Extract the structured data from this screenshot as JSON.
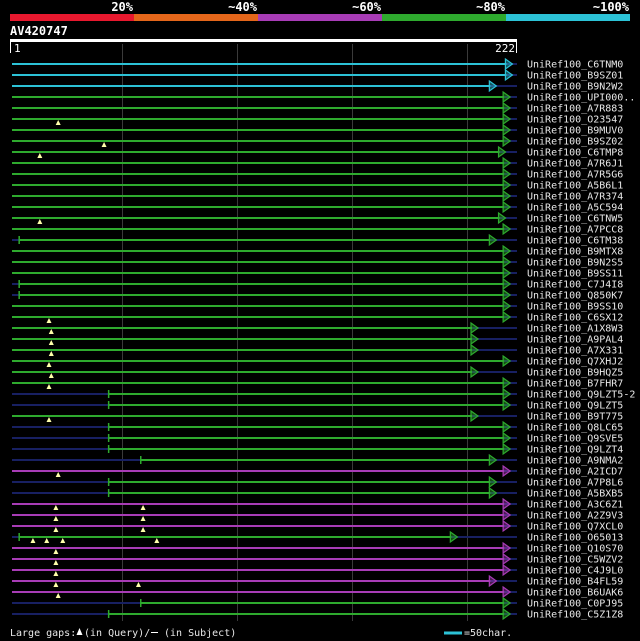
{
  "chart_data": {
    "type": "bar",
    "orientation": "horizontal",
    "query_name": "AV420747",
    "x_range": [
      1,
      222
    ],
    "x_tick_labels": [
      "1",
      "222"
    ],
    "grid": true,
    "grid_interval": 50,
    "legend_placement": "top",
    "legend": [
      {
        "label": "20%",
        "color": "#e8182e"
      },
      {
        "label": "~40%",
        "color": "#e4661a"
      },
      {
        "label": "~60%",
        "color": "#a83cb6"
      },
      {
        "label": "~80%",
        "color": "#2eaa2e"
      },
      {
        "label": "~100%",
        "color": "#2cc2d6"
      }
    ],
    "hits": [
      {
        "name": "UniRef100_C6TNM0",
        "identity": "~100%",
        "start": 1,
        "end": 220
      },
      {
        "name": "UniRef100_B9SZ01",
        "identity": "~100%",
        "start": 1,
        "end": 220
      },
      {
        "name": "UniRef100_B9N2W2",
        "identity": "~100%",
        "start": 1,
        "end": 213
      },
      {
        "name": "UniRef100_UPI000..",
        "identity": "~80%",
        "start": 1,
        "end": 219
      },
      {
        "name": "UniRef100_A7R883",
        "identity": "~80%",
        "start": 1,
        "end": 219
      },
      {
        "name": "UniRef100_O23547",
        "identity": "~80%",
        "start": 1,
        "end": 219,
        "query_gaps": [
          22
        ]
      },
      {
        "name": "UniRef100_B9MUV0",
        "identity": "~80%",
        "start": 1,
        "end": 219
      },
      {
        "name": "UniRef100_B9SZ02",
        "identity": "~80%",
        "start": 1,
        "end": 219,
        "query_gaps": [
          42
        ]
      },
      {
        "name": "UniRef100_C6TMP8",
        "identity": "~80%",
        "start": 1,
        "end": 217,
        "query_gaps": [
          14
        ]
      },
      {
        "name": "UniRef100_A7R6J1",
        "identity": "~80%",
        "start": 1,
        "end": 219
      },
      {
        "name": "UniRef100_A7R5G6",
        "identity": "~80%",
        "start": 1,
        "end": 219
      },
      {
        "name": "UniRef100_A5B6L1",
        "identity": "~80%",
        "start": 1,
        "end": 219
      },
      {
        "name": "UniRef100_A7R374",
        "identity": "~80%",
        "start": 1,
        "end": 219
      },
      {
        "name": "UniRef100_A5C594",
        "identity": "~80%",
        "start": 1,
        "end": 219
      },
      {
        "name": "UniRef100_C6TNW5",
        "identity": "~80%",
        "start": 1,
        "end": 217,
        "query_gaps": [
          14
        ]
      },
      {
        "name": "UniRef100_A7PCC8",
        "identity": "~80%",
        "start": 1,
        "end": 219
      },
      {
        "name": "UniRef100_C6TM38",
        "identity": "~80%",
        "start": 5,
        "end": 213
      },
      {
        "name": "UniRef100_B9MTX8",
        "identity": "~80%",
        "start": 1,
        "end": 219
      },
      {
        "name": "UniRef100_B9N2S5",
        "identity": "~80%",
        "start": 1,
        "end": 219
      },
      {
        "name": "UniRef100_B9SS11",
        "identity": "~80%",
        "start": 1,
        "end": 219
      },
      {
        "name": "UniRef100_C7J4I8",
        "identity": "~80%",
        "start": 5,
        "end": 219
      },
      {
        "name": "UniRef100_Q850K7",
        "identity": "~80%",
        "start": 5,
        "end": 219
      },
      {
        "name": "UniRef100_B9SS10",
        "identity": "~80%",
        "start": 1,
        "end": 219
      },
      {
        "name": "UniRef100_C6SX12",
        "identity": "~80%",
        "start": 1,
        "end": 219,
        "query_gaps": [
          18
        ]
      },
      {
        "name": "UniRef100_A1X8W3",
        "identity": "~80%",
        "start": 1,
        "end": 205,
        "query_gaps": [
          19
        ]
      },
      {
        "name": "UniRef100_A9PAL4",
        "identity": "~80%",
        "start": 1,
        "end": 205,
        "query_gaps": [
          19
        ]
      },
      {
        "name": "UniRef100_A7X331",
        "identity": "~80%",
        "start": 1,
        "end": 205,
        "query_gaps": [
          19
        ]
      },
      {
        "name": "UniRef100_Q7XHJ2",
        "identity": "~80%",
        "start": 1,
        "end": 219,
        "query_gaps": [
          18
        ]
      },
      {
        "name": "UniRef100_B9HQZ5",
        "identity": "~80%",
        "start": 1,
        "end": 205,
        "query_gaps": [
          19
        ]
      },
      {
        "name": "UniRef100_B7FHR7",
        "identity": "~80%",
        "start": 1,
        "end": 219,
        "query_gaps": [
          18
        ]
      },
      {
        "name": "UniRef100_Q9LZT5-2",
        "identity": "~80%",
        "start": 44,
        "end": 219
      },
      {
        "name": "UniRef100_Q9LZT5",
        "identity": "~80%",
        "start": 44,
        "end": 219
      },
      {
        "name": "UniRef100_B9T775",
        "identity": "~80%",
        "start": 1,
        "end": 205,
        "query_gaps": [
          18
        ]
      },
      {
        "name": "UniRef100_Q8LC65",
        "identity": "~80%",
        "start": 44,
        "end": 219
      },
      {
        "name": "UniRef100_Q9SVE5",
        "identity": "~80%",
        "start": 44,
        "end": 219
      },
      {
        "name": "UniRef100_Q9LZT4",
        "identity": "~80%",
        "start": 44,
        "end": 219
      },
      {
        "name": "UniRef100_A9NMA2",
        "identity": "~80%",
        "start": 58,
        "end": 213
      },
      {
        "name": "UniRef100_A2ICD7",
        "identity": "~60%",
        "start": 1,
        "end": 219,
        "query_gaps": [
          22
        ]
      },
      {
        "name": "UniRef100_A7P8L6",
        "identity": "~80%",
        "start": 44,
        "end": 213
      },
      {
        "name": "UniRef100_A5BXB5",
        "identity": "~80%",
        "start": 44,
        "end": 213
      },
      {
        "name": "UniRef100_A3C6Z1",
        "identity": "~60%",
        "start": 1,
        "end": 219,
        "query_gaps": [
          21,
          59
        ]
      },
      {
        "name": "UniRef100_A2Z9V3",
        "identity": "~60%",
        "start": 1,
        "end": 219,
        "query_gaps": [
          21,
          59
        ]
      },
      {
        "name": "UniRef100_Q7XCL0",
        "identity": "~60%",
        "start": 1,
        "end": 219,
        "query_gaps": [
          21,
          59
        ]
      },
      {
        "name": "UniRef100_O65013",
        "identity": "~80%",
        "start": 5,
        "end": 196,
        "query_gaps": [
          11,
          17,
          24,
          65
        ]
      },
      {
        "name": "UniRef100_Q10S70",
        "identity": "~60%",
        "start": 1,
        "end": 219,
        "query_gaps": [
          21
        ]
      },
      {
        "name": "UniRef100_C5WZV2",
        "identity": "~60%",
        "start": 1,
        "end": 219,
        "query_gaps": [
          21
        ]
      },
      {
        "name": "UniRef100_C4J9L0",
        "identity": "~60%",
        "start": 1,
        "end": 219,
        "query_gaps": [
          21
        ]
      },
      {
        "name": "UniRef100_B4FL59",
        "identity": "~60%",
        "start": 1,
        "end": 213,
        "query_gaps": [
          21,
          57
        ]
      },
      {
        "name": "UniRef100_B6UAK6",
        "identity": "~60%",
        "start": 1,
        "end": 219,
        "query_gaps": [
          22
        ]
      },
      {
        "name": "UniRef100_C0PJ95",
        "identity": "~80%",
        "start": 58,
        "end": 219
      },
      {
        "name": "UniRef100_C5Z1Z8",
        "identity": "~80%",
        "start": 44,
        "end": 219
      }
    ]
  },
  "footer": {
    "gaps_label": "Large gaps:",
    "query_gap_label": "(in Query)/",
    "subject_gap_label": "(in Subject)",
    "scale_label": "=50char."
  }
}
